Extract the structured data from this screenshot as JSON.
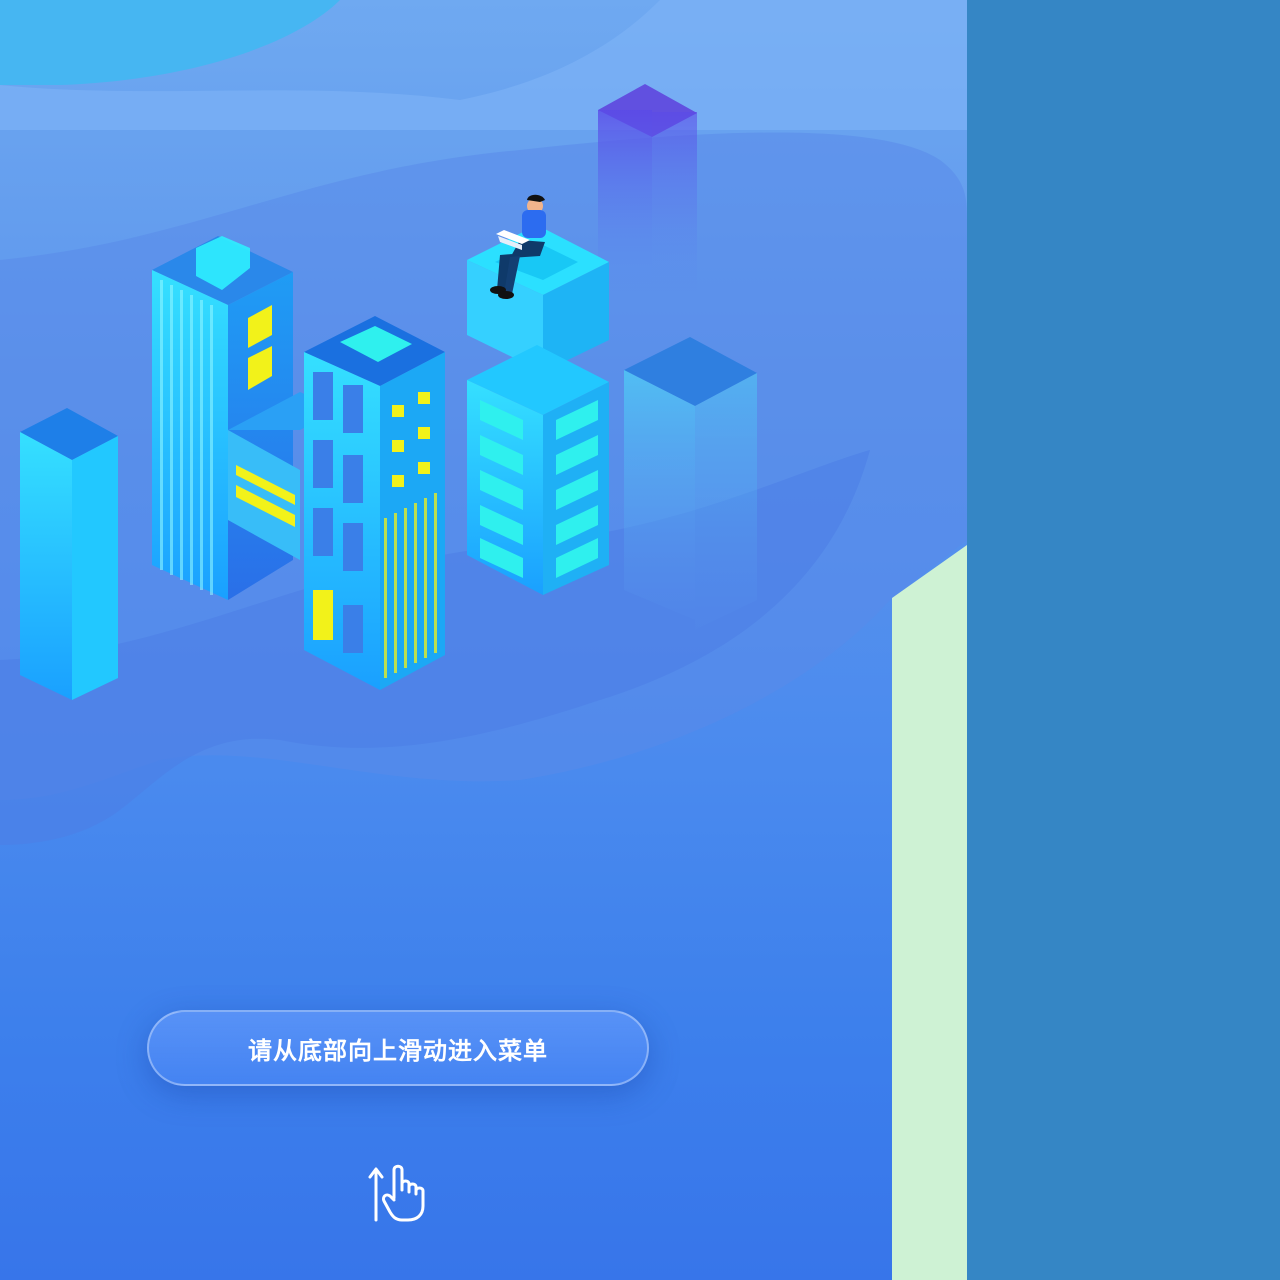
{
  "swipe_hint": {
    "label": "请从底部向上滑动进入菜单",
    "icon": "swipe-up-hand-icon"
  },
  "colors": {
    "side_panel": "#3586c5",
    "bottom_edge_strip": "#cef2d4",
    "building_cyan": "#2ad8ff",
    "window_yellow": "#f2f21a"
  }
}
